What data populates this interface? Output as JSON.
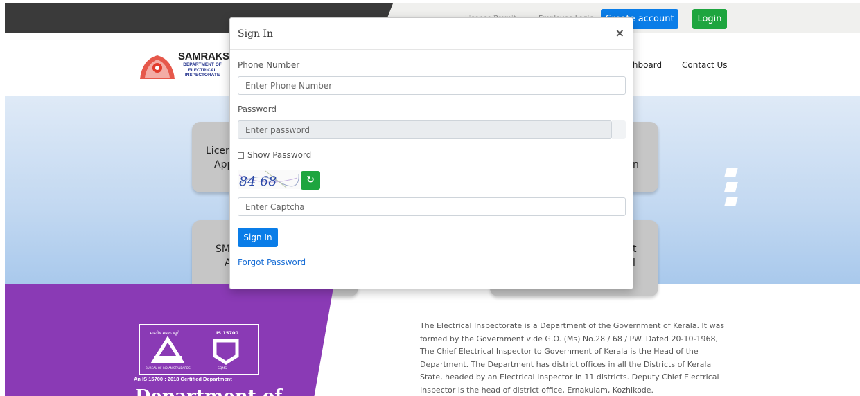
{
  "colors": {
    "primary_blue": "#0a7de8",
    "success_green": "#1ea53f",
    "footer_purple": "#8a3ab5",
    "topbar_dark": "#3a3a3a"
  },
  "topbar": {
    "link1": "Licence/Permit",
    "link2": "Employee Login",
    "create_account": "Create account",
    "login": "Login"
  },
  "brand": {
    "name": "SAMRAKSHA",
    "sub": "DEPARTMENT OF ELECTRICAL INSPECTORATE"
  },
  "nav": {
    "dashboard": "Dashboard",
    "contact": "Contact Us"
  },
  "hero_cards": [
    {
      "line1": "Licence",
      "line2": "App"
    },
    {
      "line1": "n"
    },
    {
      "line1": "SM",
      "line2": "A"
    },
    {
      "line1": "t",
      "line2": "l"
    }
  ],
  "modal": {
    "title": "Sign In",
    "close": "×",
    "phone_label": "Phone Number",
    "phone_placeholder": "Enter Phone Number",
    "password_label": "Password",
    "password_placeholder": "Enter password",
    "show_password": "Show Password",
    "captcha_digits": "84 68",
    "captcha_placeholder": "Enter Captcha",
    "signin": "Sign In",
    "forgot": "Forgot Password"
  },
  "icons": [
    "close-icon",
    "refresh-icon",
    "emblem-logo",
    "bis-certification-logo",
    "checkbox-icon"
  ],
  "footer": {
    "cert_top_left": "भारतीय मानक ब्यूरो",
    "cert_top_right": "IS 15700",
    "cert_bottom_left": "BUREAU OF INDIAN STANDARDS",
    "cert_bottom_right": "SQMS",
    "cert_caption": "An IS 15700 : 2018 Certified Department",
    "heading": "Department of",
    "about": "The Electrical Inspectorate is a Department of the Government of Kerala. It was formed by the Government vide G.O. (Ms) No.28 / 68 / PW. Dated 20-10-1968, The Chief Electrical Inspector to Government of Kerala is the Head of the Department. The Department has district offices in all the Districts of Kerala State, headed by an Electrical Inspector in 11 districts. Deputy Chief Electrical Inspector is the head of district office, Ernakulam, Kozhikode."
  }
}
